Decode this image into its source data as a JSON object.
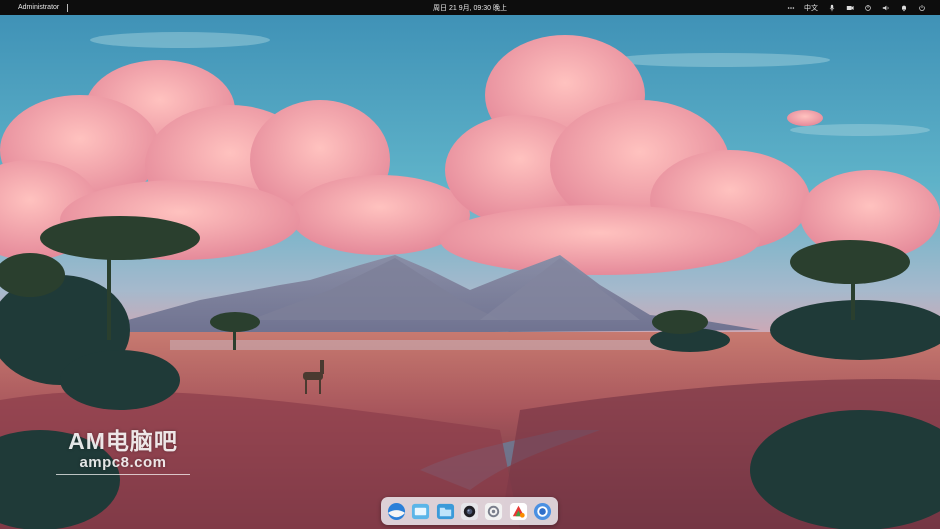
{
  "topbar": {
    "user": "Administrator",
    "datetime": "周日 21 9月, 09:30 晚上",
    "input_method": "中文",
    "icons": [
      "more-icon",
      "input-method-label",
      "microphone-icon",
      "screen-record-icon",
      "power-indicator-icon",
      "volume-icon",
      "notification-bell-icon",
      "power-icon"
    ]
  },
  "watermark": {
    "title": "AM电脑吧",
    "url": "ampc8.com"
  },
  "dock": {
    "items": [
      "launcher-icon",
      "file-manager-icon",
      "files-icon",
      "camera-icon",
      "settings-icon",
      "app-store-icon",
      "browser-icon"
    ]
  },
  "colors": {
    "topbar_bg": "#0d0d0d",
    "dock_bg": "#f0f0f5",
    "sky": "#4fa0c0",
    "cloud": "#f4a7b0",
    "grass": "#b35a5f"
  }
}
